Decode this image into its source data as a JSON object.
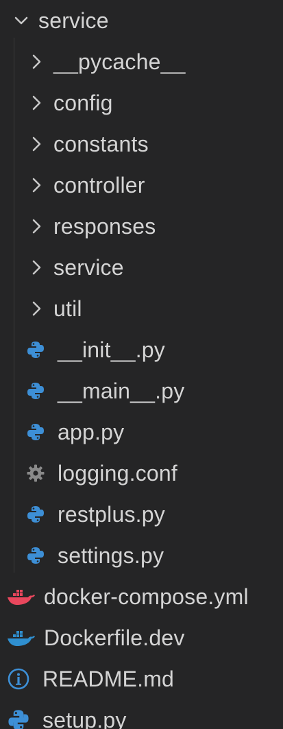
{
  "explorer": {
    "root_folder": "service",
    "folders": [
      "__pycache__",
      "config",
      "constants",
      "controller",
      "responses",
      "service",
      "util"
    ],
    "files": [
      {
        "name": "__init__.py",
        "icon": "python-icon"
      },
      {
        "name": "__main__.py",
        "icon": "python-icon"
      },
      {
        "name": "app.py",
        "icon": "python-icon"
      },
      {
        "name": "logging.conf",
        "icon": "gear-icon"
      },
      {
        "name": "restplus.py",
        "icon": "python-icon"
      },
      {
        "name": "settings.py",
        "icon": "python-icon"
      }
    ],
    "root_files": [
      {
        "name": "docker-compose.yml",
        "icon": "docker-icon",
        "color": "#e9475d"
      },
      {
        "name": "Dockerfile.dev",
        "icon": "docker-icon",
        "color": "#2f8fd0"
      },
      {
        "name": "README.md",
        "icon": "info-icon",
        "color": "#3d8fd6"
      },
      {
        "name": "setup.py",
        "icon": "python-icon",
        "color": "#3d8fd6"
      }
    ]
  },
  "colors": {
    "background": "#252526",
    "text": "#d4d4d4",
    "python": "#3d8fd6",
    "gear": "#8a8a8a",
    "docker_compose": "#e9475d",
    "dockerfile": "#2f8fd0",
    "info": "#3d8fd6"
  }
}
